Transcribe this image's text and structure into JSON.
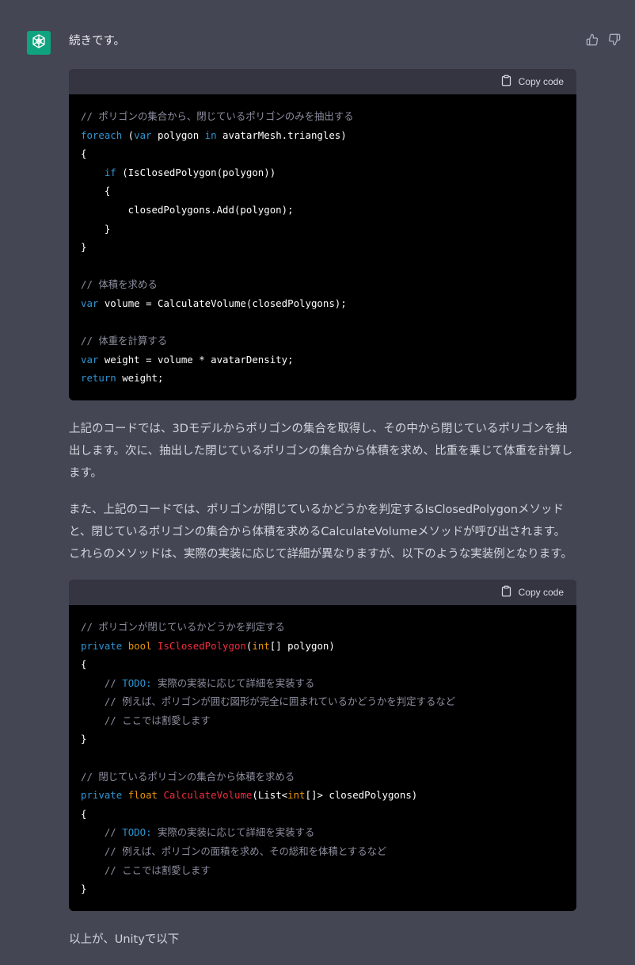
{
  "message": {
    "intro": "続きです。",
    "copy_label": "Copy code",
    "paragraph_1": "上記のコードでは、3Dモデルからポリゴンの集合を取得し、その中から閉じているポリゴンを抽出します。次に、抽出した閉じているポリゴンの集合から体積を求め、比重を乗じて体重を計算します。",
    "paragraph_2": "また、上記のコードでは、ポリゴンが閉じているかどうかを判定するIsClosedPolygonメソッドと、閉じているポリゴンの集合から体積を求めるCalculateVolumeメソッドが呼び出されます。これらのメソッドは、実際の実装に応じて詳細が異なりますが、以下のような実装例となります。",
    "paragraph_3": "以上が、Unityで以下"
  },
  "code_blocks": [
    {
      "lines": [
        [
          {
            "t": "// ポリゴンの集合から、閉じているポリゴンのみを抽出する",
            "c": "cm"
          }
        ],
        [
          {
            "t": "foreach",
            "c": "kw"
          },
          {
            "t": " ("
          },
          {
            "t": "var",
            "c": "kw"
          },
          {
            "t": " polygon "
          },
          {
            "t": "in",
            "c": "kw"
          },
          {
            "t": " avatarMesh.triangles)"
          }
        ],
        [
          {
            "t": "{"
          }
        ],
        [
          {
            "t": "    "
          },
          {
            "t": "if",
            "c": "kw"
          },
          {
            "t": " (IsClosedPolygon(polygon))"
          }
        ],
        [
          {
            "t": "    {"
          }
        ],
        [
          {
            "t": "        closedPolygons.Add(polygon);"
          }
        ],
        [
          {
            "t": "    }"
          }
        ],
        [
          {
            "t": "}"
          }
        ],
        [],
        [
          {
            "t": "// 体積を求める",
            "c": "cm"
          }
        ],
        [
          {
            "t": "var",
            "c": "kw"
          },
          {
            "t": " volume = CalculateVolume(closedPolygons);"
          }
        ],
        [],
        [
          {
            "t": "// 体重を計算する",
            "c": "cm"
          }
        ],
        [
          {
            "t": "var",
            "c": "kw"
          },
          {
            "t": " weight = volume * avatarDensity;"
          }
        ],
        [
          {
            "t": "return",
            "c": "kw"
          },
          {
            "t": " weight;"
          }
        ]
      ]
    },
    {
      "lines": [
        [
          {
            "t": "// ポリゴンが閉じているかどうかを判定する",
            "c": "cm"
          }
        ],
        [
          {
            "t": "private",
            "c": "kw"
          },
          {
            "t": " "
          },
          {
            "t": "bool",
            "c": "ty"
          },
          {
            "t": " "
          },
          {
            "t": "IsClosedPolygon",
            "c": "fn"
          },
          {
            "t": "("
          },
          {
            "t": "int",
            "c": "ty"
          },
          {
            "t": "[] polygon)"
          }
        ],
        [
          {
            "t": "{"
          }
        ],
        [
          {
            "t": "    "
          },
          {
            "t": "// ",
            "c": "cm"
          },
          {
            "t": "TODO:",
            "c": "td"
          },
          {
            "t": " 実際の実装に応じて詳細を実装する",
            "c": "cm"
          }
        ],
        [
          {
            "t": "    "
          },
          {
            "t": "// 例えば、ポリゴンが囲む図形が完全に囲まれているかどうかを判定するなど",
            "c": "cm"
          }
        ],
        [
          {
            "t": "    "
          },
          {
            "t": "// ここでは割愛します",
            "c": "cm"
          }
        ],
        [
          {
            "t": "}"
          }
        ],
        [],
        [
          {
            "t": "// 閉じているポリゴンの集合から体積を求める",
            "c": "cm"
          }
        ],
        [
          {
            "t": "private",
            "c": "kw"
          },
          {
            "t": " "
          },
          {
            "t": "float",
            "c": "ty"
          },
          {
            "t": " "
          },
          {
            "t": "CalculateVolume",
            "c": "fn"
          },
          {
            "t": "(List<"
          },
          {
            "t": "int",
            "c": "ty"
          },
          {
            "t": "[]> closedPolygons)"
          }
        ],
        [
          {
            "t": "{"
          }
        ],
        [
          {
            "t": "    "
          },
          {
            "t": "// ",
            "c": "cm"
          },
          {
            "t": "TODO:",
            "c": "td"
          },
          {
            "t": " 実際の実装に応じて詳細を実装する",
            "c": "cm"
          }
        ],
        [
          {
            "t": "    "
          },
          {
            "t": "// 例えば、ポリゴンの面積を求め、その総和を体積とするなど",
            "c": "cm"
          }
        ],
        [
          {
            "t": "    "
          },
          {
            "t": "// ここでは割愛します",
            "c": "cm"
          }
        ],
        [
          {
            "t": "}"
          }
        ]
      ]
    }
  ],
  "icons": {
    "avatar": "openai-logo-icon",
    "thumbs_up": "thumbs-up-icon",
    "thumbs_down": "thumbs-down-icon",
    "copy": "clipboard-icon"
  },
  "colors": {
    "background": "#444654",
    "avatar": "#10a37f",
    "code_bg": "#000000",
    "code_header": "#343541",
    "keyword": "#2e95d3",
    "function": "#f22c3d",
    "type": "#e9950c",
    "comment": "#8e8ea0"
  }
}
